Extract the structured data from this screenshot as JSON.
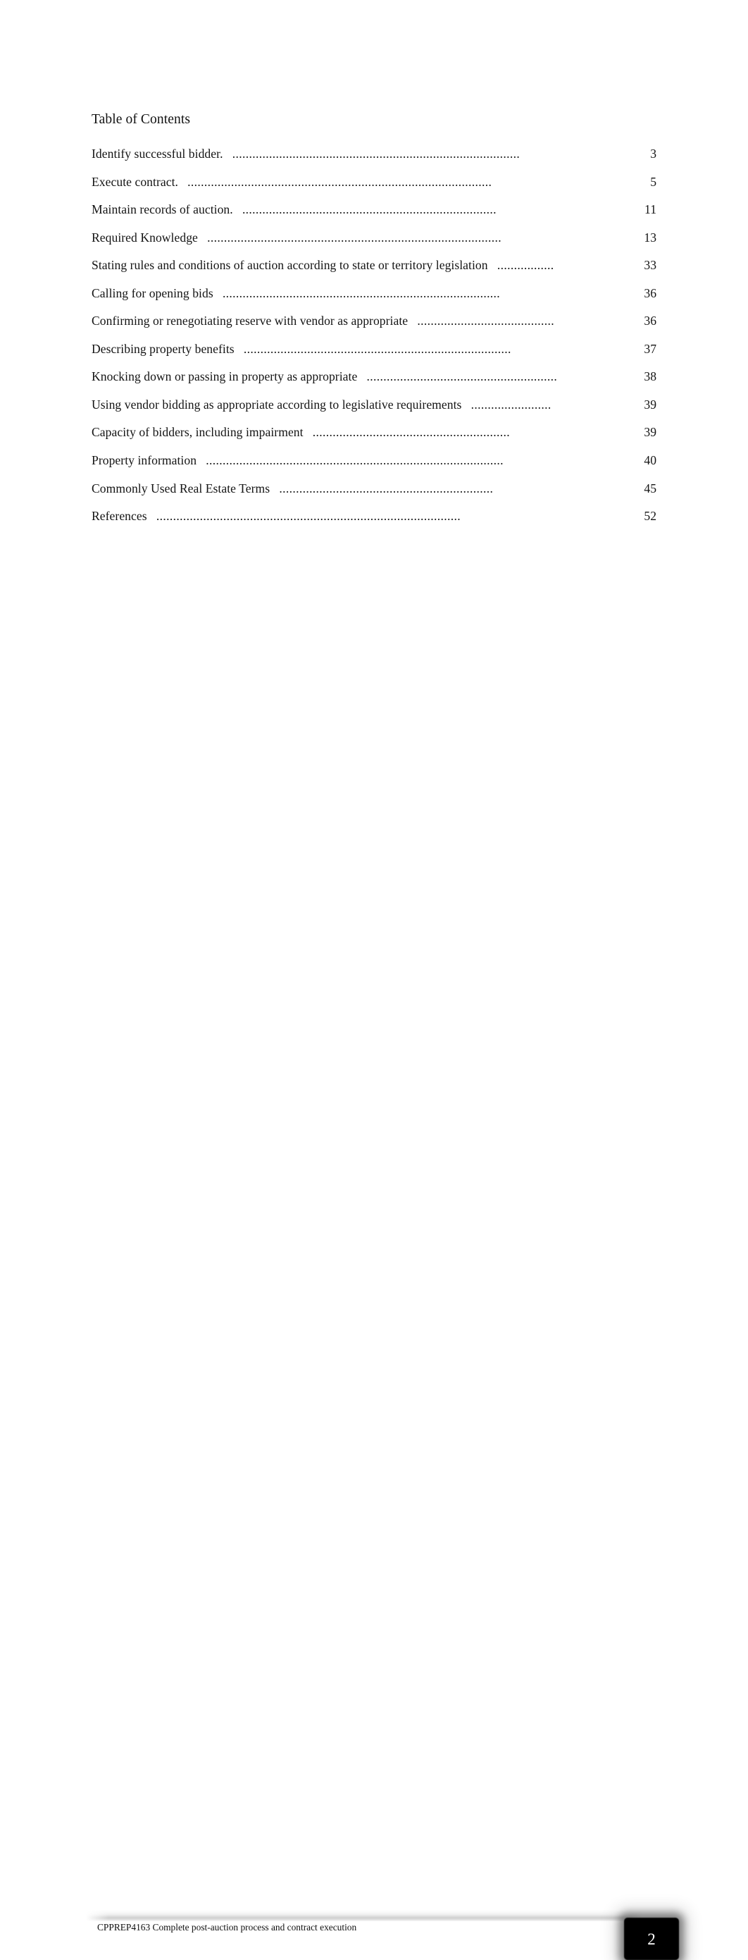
{
  "document": {
    "title": "Table of Contents"
  },
  "toc": {
    "entries": [
      {
        "label": "Identify successful bidder.",
        "leader": "......................................................................................",
        "page": "3"
      },
      {
        "label": "Execute contract.",
        "leader": "...........................................................................................",
        "page": "5"
      },
      {
        "label": "Maintain records of auction.",
        "leader": "............................................................................",
        "page": "11"
      },
      {
        "label": "Required Knowledge",
        "leader": "........................................................................................",
        "page": "13"
      },
      {
        "label": "Stating rules and conditions of auction according to state or territory legislation",
        "leader": ".................",
        "page": "33"
      },
      {
        "label": "Calling for opening bids",
        "leader": "...................................................................................",
        "page": "36"
      },
      {
        "label": "Confirming or renegotiating reserve with vendor as appropriate",
        "leader": ".........................................",
        "page": "36"
      },
      {
        "label": "Describing property benefits",
        "leader": "................................................................................",
        "page": "37"
      },
      {
        "label": "Knocking down or passing in property as appropriate",
        "leader": ".........................................................",
        "page": "38"
      },
      {
        "label": "Using vendor bidding as appropriate according to legislative requirements",
        "leader": "........................",
        "page": "39"
      },
      {
        "label": "Capacity of bidders, including impairment",
        "leader": "...........................................................",
        "page": "39"
      },
      {
        "label": "Property information",
        "leader": ".........................................................................................",
        "page": "40"
      },
      {
        "label": "Commonly Used Real Estate Terms",
        "leader": "................................................................",
        "page": "45"
      },
      {
        "label": "References",
        "leader": "...........................................................................................",
        "page": "52"
      }
    ]
  },
  "footer": {
    "text": "CPPREP4163 Complete post-auction process and contract execution",
    "page_number": "2"
  }
}
